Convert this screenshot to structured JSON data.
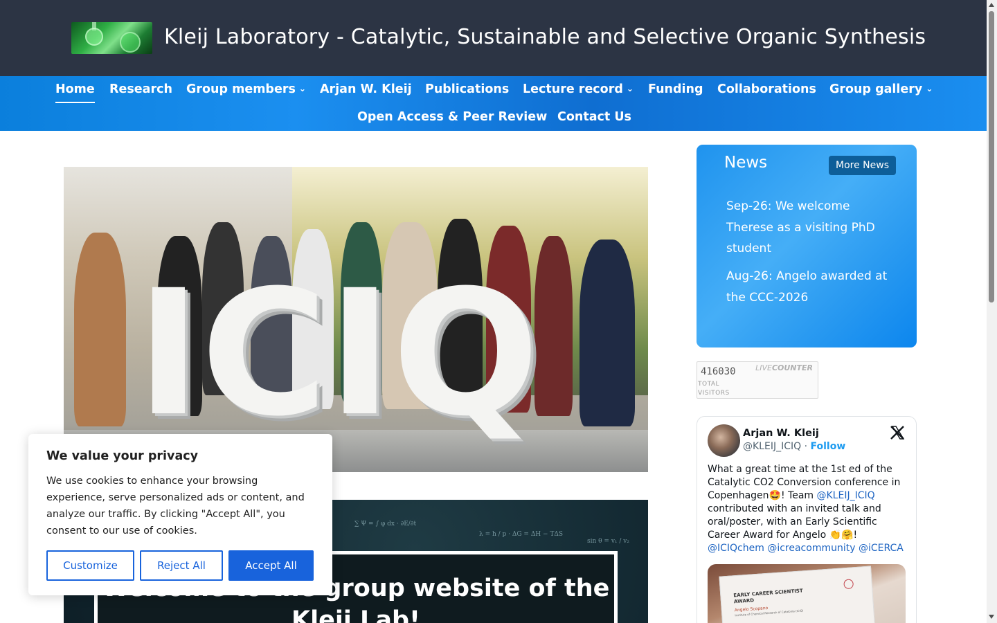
{
  "header": {
    "site_title": "Kleij Laboratory - Catalytic, Sustainable and Selective Organic Synthesis",
    "logo_icon": "chemistry-flasks-logo",
    "background": "#2c3444"
  },
  "nav": {
    "accent": "#0b7fdc",
    "items": [
      {
        "label": "Home",
        "active": true,
        "dropdown": false
      },
      {
        "label": "Research",
        "dropdown": false
      },
      {
        "label": "Group members",
        "dropdown": true
      },
      {
        "label": "Arjan W. Kleij",
        "dropdown": false
      },
      {
        "label": "Publications",
        "dropdown": false
      },
      {
        "label": "Lecture record",
        "dropdown": true
      },
      {
        "label": "Funding",
        "dropdown": false
      },
      {
        "label": "Collaborations",
        "dropdown": false
      },
      {
        "label": "Group gallery",
        "dropdown": true
      },
      {
        "label": "Open Access & Peer Review",
        "dropdown": false
      },
      {
        "label": "Contact Us",
        "dropdown": false
      }
    ],
    "chevron": "⌄"
  },
  "hero": {
    "photo_letters": "ICIQ",
    "banner_text": "Welcome to the group website of the Kleij Lab!"
  },
  "news": {
    "title": "News",
    "more_button": "More News",
    "items": [
      "Sep-26: We welcome Therese as a visiting PhD student",
      "Aug-26: Angelo awarded at the CCC-2026"
    ]
  },
  "counter": {
    "value": "416030",
    "brand_light": "LIVE",
    "brand_bold": "COUNTER",
    "label_line1": "TOTAL",
    "label_line2": "VISITORS"
  },
  "tweet": {
    "name": "Arjan W. Kleij",
    "handle": "@KLEIJ_ICIQ",
    "separator": "·",
    "follow": "Follow",
    "text_1": "What a great time at the 1st ed of the Catalytic CO2 Conversion conference in Copenhagen🤩! Team ",
    "mention_1": "@KLEIJ_ICIQ",
    "text_2": " contributed with an invited talk and oral/poster, with an Early Scientific Career Award for Angelo 👏🤗! ",
    "mention_2": "@ICIQchem",
    "mention_3": "@icreacommunity",
    "mention_4": "@iCERCA",
    "image_cert_title": "EARLY CAREER SCIENTIST AWARD",
    "image_cert_name": "Angelo Scopano",
    "image_cert_org": "Institute of Chemical Research of Catalonia (ICIQ)"
  },
  "cookie": {
    "title": "We value your privacy",
    "text": "We use cookies to enhance your browsing experience, serve personalized ads or content, and analyze our traffic. By clicking \"Accept All\", you consent to our use of cookies.",
    "customize": "Customize",
    "reject": "Reject All",
    "accept": "Accept All",
    "accent": "#1863dc"
  }
}
